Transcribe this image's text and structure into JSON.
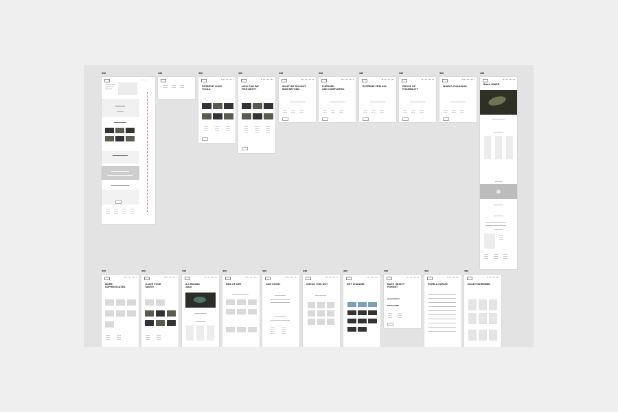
{
  "screens": {
    "s_home_wire": {
      "heading": ""
    },
    "s_deserve": {
      "heading": "DESERVE YOUR\nTOOLS"
    },
    "s_how": {
      "heading": "HOW CAN WE\nFISH NEXT?"
    },
    "s_sought": {
      "heading": "WHAT WE SOUGHT\nWAS BEYOND"
    },
    "s_pursued": {
      "heading": "PURSUED\nAND COMPLETED."
    },
    "s_extreme": {
      "heading": "EXTREME FEELING"
    },
    "s_proof": {
      "heading": "PROOF OF\nPOSSIBILITY"
    },
    "s_world": {
      "heading": "WORLD CHANGING"
    },
    "s_black": {
      "heading": "Black JOKER"
    },
    "s_more": {
      "heading": "MORE\nSOPHISTICATED"
    },
    "s_love": {
      "heading": "I LOVE YOUR\nTASTE!"
    },
    "s_booms": {
      "heading": "A-1 BOOMS\nJoker"
    },
    "s_dna": {
      "heading": "DNA OF DRT"
    },
    "s_story": {
      "heading": "OUR STORY"
    },
    "s_check": {
      "heading": "CHECK THIS OUT"
    },
    "s_channel": {
      "heading": "DRT CHANNEL"
    },
    "s_days": {
      "heading": "DAYS I WON'T\nFORGET"
    },
    "s_scrum": {
      "heading": "FORM A SCRUM"
    },
    "s_dear": {
      "heading": "DEAR FISHERMEN"
    }
  },
  "labels": {
    "days_handle": "@sevenmill.drt",
    "days_tag": "THEKLASHER"
  },
  "colors": {
    "background": "#efefef",
    "canvas": "#e3e3e3",
    "artboard": "#ffffff",
    "annotation_red": "#e06a6a",
    "media_blue": "#7aa2b4"
  }
}
